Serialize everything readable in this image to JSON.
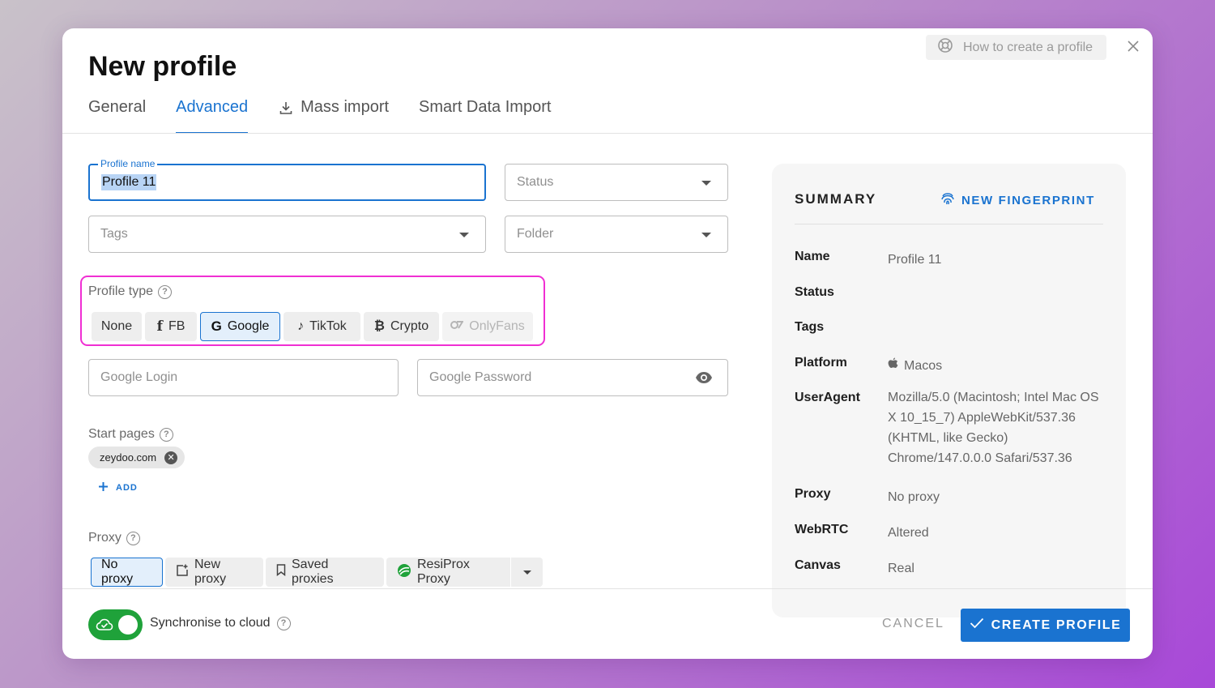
{
  "modal": {
    "title": "New profile",
    "help_label": "How to create a profile"
  },
  "tabs": [
    {
      "label": "General"
    },
    {
      "label": "Advanced"
    },
    {
      "label": "Mass import"
    },
    {
      "label": "Smart Data Import"
    }
  ],
  "form": {
    "profile_name_label": "Profile name",
    "profile_name_value": "Profile 11",
    "status_placeholder": "Status",
    "tags_placeholder": "Tags",
    "folder_placeholder": "Folder",
    "profile_type_label": "Profile type",
    "profile_types": [
      "None",
      "FB",
      "Google",
      "TikTok",
      "Crypto",
      "OnlyFans"
    ],
    "profile_type_selected": "Google",
    "google_login_placeholder": "Google Login",
    "google_password_placeholder": "Google Password",
    "start_pages_label": "Start pages",
    "start_pages": [
      "zeydoo.com"
    ],
    "add_label": "ADD",
    "proxy_label": "Proxy",
    "proxy_options": [
      "No proxy",
      "New proxy",
      "Saved proxies",
      "ResiProx Proxy"
    ],
    "proxy_selected": "No proxy"
  },
  "summary": {
    "title": "SUMMARY",
    "new_fingerprint_label": "NEW FINGERPRINT",
    "rows": [
      {
        "key": "Name",
        "value": "Profile 11"
      },
      {
        "key": "Status",
        "value": ""
      },
      {
        "key": "Tags",
        "value": ""
      },
      {
        "key": "Platform",
        "value": "Macos"
      },
      {
        "key": "UserAgent",
        "value": "Mozilla/5.0 (Macintosh; Intel Mac OS X 10_15_7) AppleWebKit/537.36 (KHTML, like Gecko) Chrome/147.0.0.0 Safari/537.36"
      },
      {
        "key": "Proxy",
        "value": "No proxy"
      },
      {
        "key": "WebRTC",
        "value": "Altered"
      },
      {
        "key": "Canvas",
        "value": "Real"
      }
    ]
  },
  "footer": {
    "sync_label": "Synchronise to cloud",
    "sync_enabled": true,
    "cancel_label": "CANCEL",
    "create_label": "CREATE PROFILE"
  },
  "colors": {
    "accent": "#1a73d0",
    "highlight_border": "#f02fd3",
    "toggle_on": "#1fa23a"
  }
}
